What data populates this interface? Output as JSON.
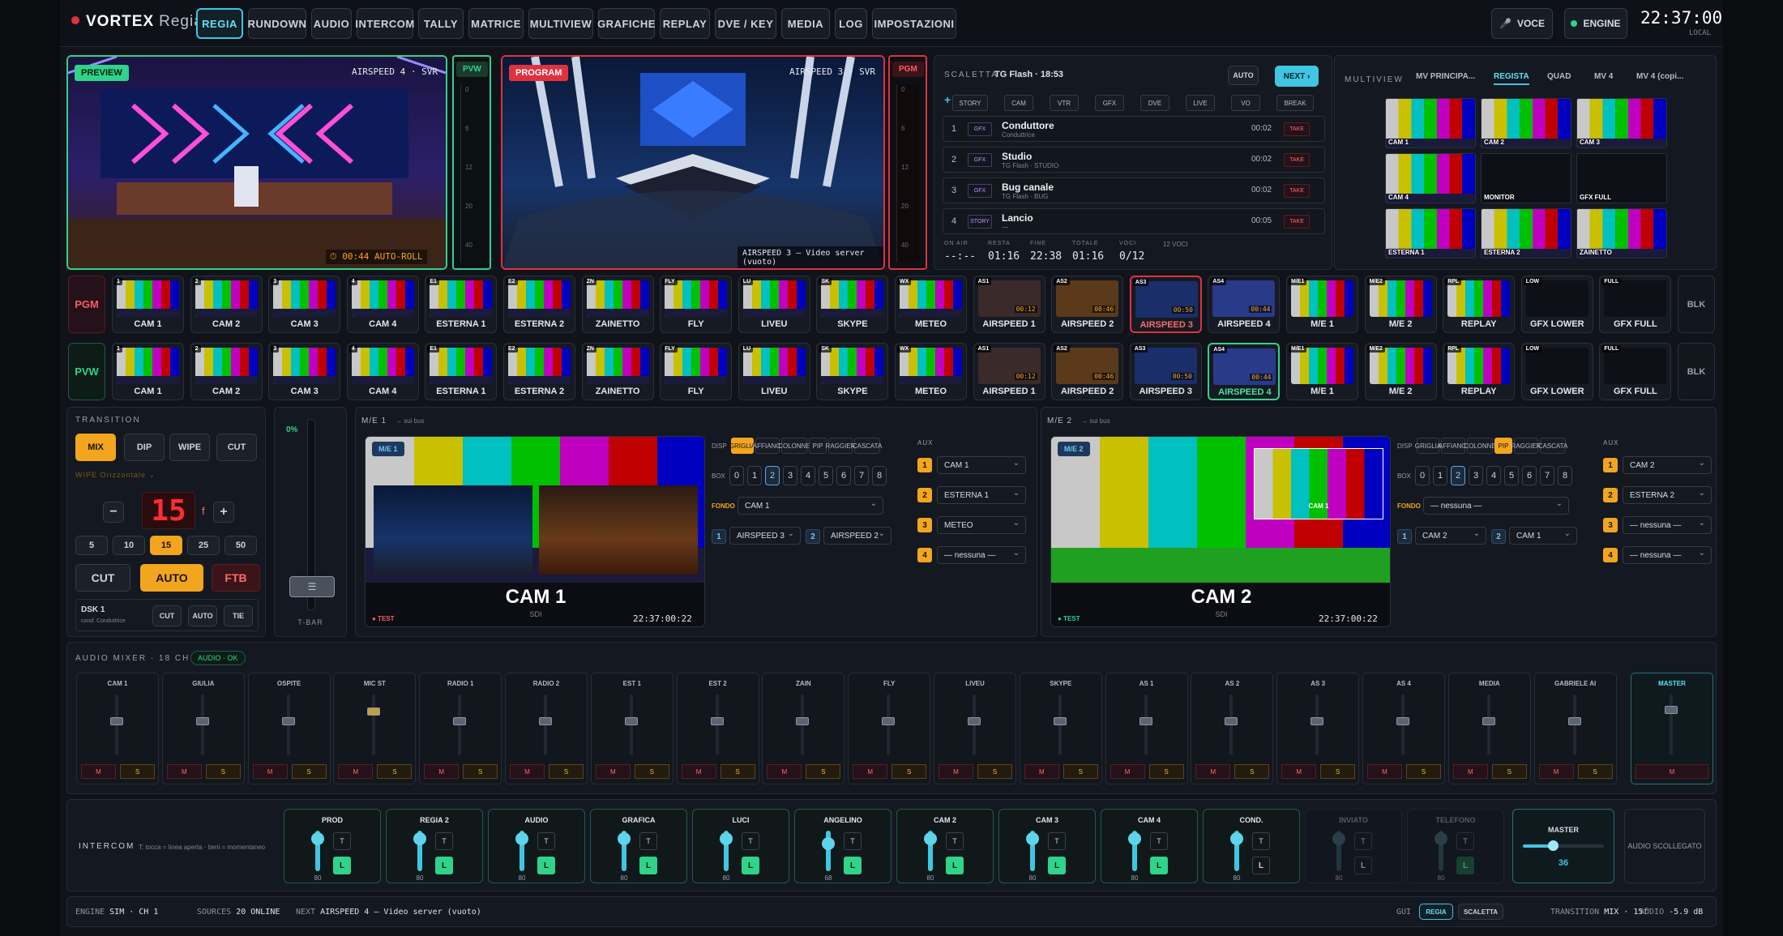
{
  "brand": {
    "name": "VORTEX",
    "sub": "Regia"
  },
  "nav": [
    "REGIA",
    "RUNDOWN",
    "AUDIO",
    "INTERCOM",
    "TALLY",
    "MATRICE",
    "MULTIVIEW",
    "GRAFICHE",
    "REPLAY",
    "DVE / KEY",
    "MEDIA",
    "LOG",
    "IMPOSTAZIONI"
  ],
  "header": {
    "voce": "VOCE",
    "engine": "ENGINE",
    "clock": "22:37:00",
    "clock_sub": "LOCAL"
  },
  "preview": {
    "tag": "PREVIEW",
    "source": "AIRSPEED 4 · SVR",
    "timer": "00:44",
    "roll": "AUTO-ROLL",
    "vu_tag": "PVW"
  },
  "program": {
    "tag": "PROGRAM",
    "source": "AIRSPEED 3 · SVR",
    "caption": "AIRSPEED 3 — Video server (vuoto)",
    "vu_tag": "PGM"
  },
  "vu_ticks": [
    "0",
    "6",
    "12",
    "20",
    "40"
  ],
  "rundown": {
    "label": "SCALETTA",
    "title": "TG Flash · 18:53",
    "auto": "AUTO",
    "next": "NEXT ›",
    "plus": "+",
    "chips": [
      "STORY",
      "CAM",
      "VTR",
      "GFX",
      "DVE",
      "LIVE",
      "VO",
      "BREAK"
    ],
    "rows": [
      {
        "n": "1",
        "type": "GFX",
        "title": "Conduttore",
        "sub": "Conduttrice",
        "dur": "00:02",
        "take": "TAKE"
      },
      {
        "n": "2",
        "type": "GFX",
        "title": "Studio",
        "sub": "TG Flash · STUDIO",
        "dur": "00:02",
        "take": "TAKE"
      },
      {
        "n": "3",
        "type": "GFX",
        "title": "Bug canale",
        "sub": "TG Flash · BUG",
        "dur": "00:02",
        "take": "TAKE"
      },
      {
        "n": "4",
        "type": "STORY",
        "title": "Lancio",
        "sub": "—",
        "dur": "00:05",
        "take": "TAKE"
      }
    ],
    "stats": {
      "onair_l": "ON AIR",
      "onair": "--:--",
      "resta_l": "RESTA",
      "resta": "01:16",
      "fine_l": "FINE",
      "fine": "22:38",
      "tot_l": "TOTALE",
      "tot": "01:16",
      "voci_l": "VOCI",
      "voci": "0/12",
      "count": "12 VOCI"
    }
  },
  "multiview": {
    "label": "MULTIVIEW",
    "tabs": [
      "MV PRINCIPA...",
      "REGISTA",
      "QUAD",
      "MV 4",
      "MV 4 (copi..."
    ],
    "tiles": [
      "CAM 1",
      "CAM 2",
      "CAM 3",
      "CAM 4",
      "MONITOR",
      "GFX FULL",
      "ESTERNA 1",
      "ESTERNA 2",
      "ZAINETTO"
    ]
  },
  "bus": {
    "pgm": "PGM",
    "pvw": "PVW",
    "blk": "BLK",
    "sources": [
      {
        "name": "CAM 1",
        "badge": "1"
      },
      {
        "name": "CAM 2",
        "badge": "2"
      },
      {
        "name": "CAM 3",
        "badge": "3"
      },
      {
        "name": "CAM 4",
        "badge": "4"
      },
      {
        "name": "ESTERNA 1",
        "badge": "E1"
      },
      {
        "name": "ESTERNA 2",
        "badge": "E2"
      },
      {
        "name": "ZAINETTO",
        "badge": "ZN"
      },
      {
        "name": "FLY",
        "badge": "FLY"
      },
      {
        "name": "LIVEU",
        "badge": "LU"
      },
      {
        "name": "SKYPE",
        "badge": "SK"
      },
      {
        "name": "METEO",
        "badge": "WX"
      },
      {
        "name": "AIRSPEED 1",
        "badge": "AS1",
        "t": "00:12"
      },
      {
        "name": "AIRSPEED 2",
        "badge": "AS2",
        "t": "00:46"
      },
      {
        "name": "AIRSPEED 3",
        "badge": "AS3",
        "t": "00:50"
      },
      {
        "name": "AIRSPEED 4",
        "badge": "AS4",
        "t": "00:44"
      },
      {
        "name": "M/E 1",
        "badge": "M/E1"
      },
      {
        "name": "M/E 2",
        "badge": "M/E2"
      },
      {
        "name": "REPLAY",
        "badge": "RPL"
      },
      {
        "name": "GFX LOWER",
        "badge": "LOW"
      },
      {
        "name": "GFX FULL",
        "badge": "FULL"
      }
    ]
  },
  "transition": {
    "label": "TRANSITION",
    "types": [
      "MIX",
      "DIP",
      "WIPE",
      "CUT"
    ],
    "wipe_l": "WIPE",
    "wipe_v": "Orizzontale ⌄",
    "minus": "−",
    "plus": "+",
    "rate": "15",
    "unit": "f",
    "presets": [
      "5",
      "10",
      "15",
      "25",
      "50"
    ],
    "cut": "CUT",
    "auto": "AUTO",
    "ftb": "FTB",
    "dsk": "DSK 1",
    "dsk_sub": "cond: Conduttrice",
    "dsk_btns": [
      "CUT",
      "AUTO",
      "TIE"
    ],
    "tbar_pct": "0%",
    "tbar_l": "T-BAR"
  },
  "me1": {
    "title": "M/E 1",
    "bus": "→ sui bus",
    "tag": "M/E 1",
    "src": "CAM 1",
    "fmt": "SDI",
    "test": "● TEST",
    "tc": "22:37:00:22",
    "disp_l": "DISP",
    "disp": [
      "GRIGLIA",
      "AFFIANC.",
      "COLONNE",
      "PIP",
      "RAGGIER",
      "CASCATA"
    ],
    "box_l": "BOX",
    "boxes": [
      "0",
      "1",
      "2",
      "3",
      "4",
      "5",
      "6",
      "7",
      "8"
    ],
    "fondo_l": "FONDO",
    "fondo": "CAM 1",
    "b1": "AIRSPEED 3",
    "b2": "AIRSPEED 2",
    "aux_l": "AUX",
    "aux": [
      "CAM 1",
      "ESTERNA 1",
      "METEO",
      "— nessuna —"
    ]
  },
  "me2": {
    "title": "M/E 2",
    "bus": "→ sui bus",
    "tag": "M/E 2",
    "src": "CAM 2",
    "fmt": "SDI",
    "test": "● TEST",
    "tc": "22:37:00:22",
    "pip": "CAM 1",
    "disp_l": "DISP",
    "disp": [
      "GRIGLIA",
      "AFFIANC.",
      "COLONNE",
      "PIP",
      "RAGGIER",
      "CASCATA"
    ],
    "box_l": "BOX",
    "boxes": [
      "0",
      "1",
      "2",
      "3",
      "4",
      "5",
      "6",
      "7",
      "8"
    ],
    "fondo_l": "FONDO",
    "fondo": "— nessuna —",
    "b1": "CAM 2",
    "b2": "CAM 1",
    "aux_l": "AUX",
    "aux": [
      "CAM 2",
      "ESTERNA 2",
      "— nessuna —",
      "— nessuna —"
    ]
  },
  "audio": {
    "label": "AUDIO MIXER · 18 CH",
    "status": "AUDIO · OK",
    "m": "M",
    "s": "S",
    "channels": [
      "CAM 1",
      "GIULIA",
      "OSPITE",
      "MIC ST",
      "RADIO 1",
      "RADIO 2",
      "EST 1",
      "EST 2",
      "ZAIN",
      "FLY",
      "LIVEU",
      "SKYPE",
      "AS 1",
      "AS 2",
      "AS 3",
      "AS 4",
      "MEDIA",
      "GABRIELE AI"
    ],
    "master": "MASTER"
  },
  "intercom": {
    "label": "INTERCOM",
    "hint": "T: tocca = linea aperta · tieni = momentaneo",
    "t": "T",
    "l": "L",
    "stations": [
      {
        "name": "PROD",
        "v": "80"
      },
      {
        "name": "REGIA 2",
        "v": "80"
      },
      {
        "name": "AUDIO",
        "v": "80"
      },
      {
        "name": "GRAFICA",
        "v": "80"
      },
      {
        "name": "LUCI",
        "v": "80"
      },
      {
        "name": "ANGELINO",
        "v": "68"
      },
      {
        "name": "CAM 2",
        "v": "80"
      },
      {
        "name": "CAM 3",
        "v": "80"
      },
      {
        "name": "CAM 4",
        "v": "80"
      },
      {
        "name": "COND.",
        "v": "80"
      },
      {
        "name": "INVIATO",
        "v": "80"
      },
      {
        "name": "TELEFONO",
        "v": "80"
      }
    ],
    "master_l": "MASTER",
    "master_v": "36",
    "off": "AUDIO SCOLLEGATO"
  },
  "status": {
    "engine_l": "ENGINE",
    "engine": "SIM · CH 1",
    "sources_l": "SOURCES",
    "sources": "20 ONLINE",
    "next_l": "NEXT",
    "next": "AIRSPEED 4 — Video server (vuoto)",
    "gui_l": "GUI",
    "gui": [
      "REGIA",
      "SCALETTA"
    ],
    "trans_l": "TRANSITION",
    "trans": "MIX · 15f",
    "audio_l": "AUDIO",
    "audio": "-5.9 dB"
  },
  "colors": {
    "accent": "#3fc6e0",
    "pgm": "#e0313f",
    "pvw": "#2fd38a",
    "amber": "#f2a51f"
  }
}
